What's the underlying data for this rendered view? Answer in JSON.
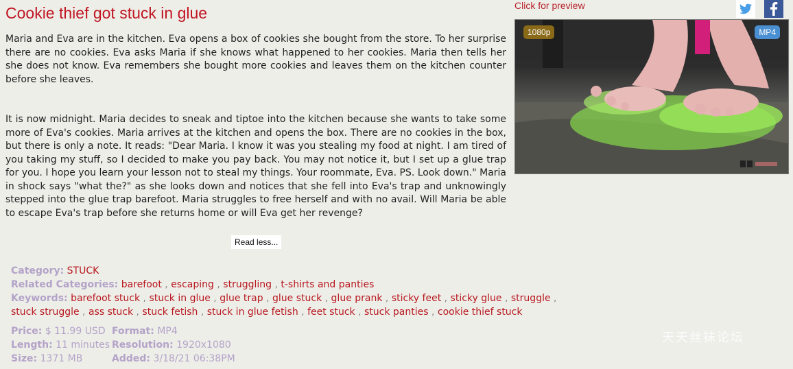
{
  "title": "Cookie thief got stuck in glue",
  "description": [
    "Maria and Eva are in the kitchen. Eva opens a box of cookies she bought from the store. To her surprise there are no cookies. Eva asks Maria if she knows what happened to her cookies. Maria then tells her she does not know. Eva remembers she bought more cookies and leaves them on the kitchen counter before she leaves.",
    "It is now midnight. Maria decides to sneak and tiptoe into the kitchen because she wants to take some more of Eva's cookies. Maria arrives at the kitchen and opens the box. There are no cookies in the box, but there is only a note. It reads: \"Dear Maria. I know it was you stealing my food at night. I am tired of you taking my stuff, so I decided to make you pay back. You may not notice it, but I set up a glue trap for you. I hope you learn your lesson not to steal my things. Your roommate, Eva. PS. Look down.\" Maria in shock says \"what the?\" as she looks down and notices that she fell into Eva's trap and unknowingly stepped into the glue trap barefoot. Maria struggles to free herself and with no avail. Will Maria be able to escape Eva's trap before she returns home or will Eva get her revenge?"
  ],
  "read_less_label": "Read less...",
  "preview": {
    "link_label": "Click for preview",
    "resolution_badge": "1080p",
    "format_badge": "MP4"
  },
  "share": {
    "twitter_icon": "twitter-icon",
    "facebook_icon": "facebook-icon"
  },
  "meta": {
    "category_label": "Category:",
    "category": "STUCK",
    "related_label": "Related Categories:",
    "related": [
      "barefoot",
      "escaping",
      "struggling",
      "t-shirts and panties"
    ],
    "keywords_label": "Keywords:",
    "keywords": [
      "barefoot stuck",
      "stuck in glue",
      "glue trap",
      "glue stuck",
      "glue prank",
      "sticky feet",
      "sticky glue",
      "struggle",
      "stuck struggle",
      "ass stuck",
      "stuck fetish",
      "stuck in glue fetish",
      "feet stuck",
      "stuck panties",
      "cookie thief stuck"
    ]
  },
  "info": {
    "price_label": "Price:",
    "price": "$ 11.99 USD",
    "length_label": "Length:",
    "length": "11 minutes",
    "size_label": "Size:",
    "size": "1371 MB",
    "format_label": "Format:",
    "format": "MP4",
    "resolution_label": "Resolution:",
    "resolution": "1920x1080",
    "added_label": "Added:",
    "added": "3/18/21 06:38PM"
  },
  "watermark": "天天丝袜论坛",
  "colors": {
    "title": "#c01622",
    "link": "#b8181f",
    "label": "#b3a3c8",
    "background": "#eeeee9"
  }
}
